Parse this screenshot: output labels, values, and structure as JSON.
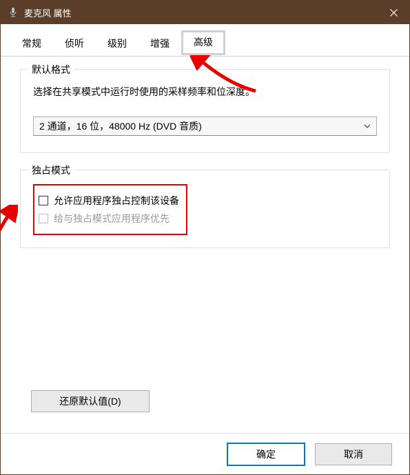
{
  "title": "麦克风 属性",
  "tabs": [
    "常规",
    "侦听",
    "级别",
    "增强",
    "高级"
  ],
  "active_tab_index": 4,
  "group_format": {
    "title": "默认格式",
    "desc": "选择在共享模式中运行时使用的采样频率和位深度。",
    "selected": "2 通道，16 位，48000 Hz (DVD 音质)"
  },
  "group_exclusive": {
    "title": "独占模式",
    "chk1": "允许应用程序独占控制该设备",
    "chk2": "给与独占模式应用程序优先"
  },
  "restore_label": "还原默认值(D)",
  "buttons": {
    "ok": "确定",
    "cancel": "取消"
  },
  "annotation_color": "#e60000"
}
